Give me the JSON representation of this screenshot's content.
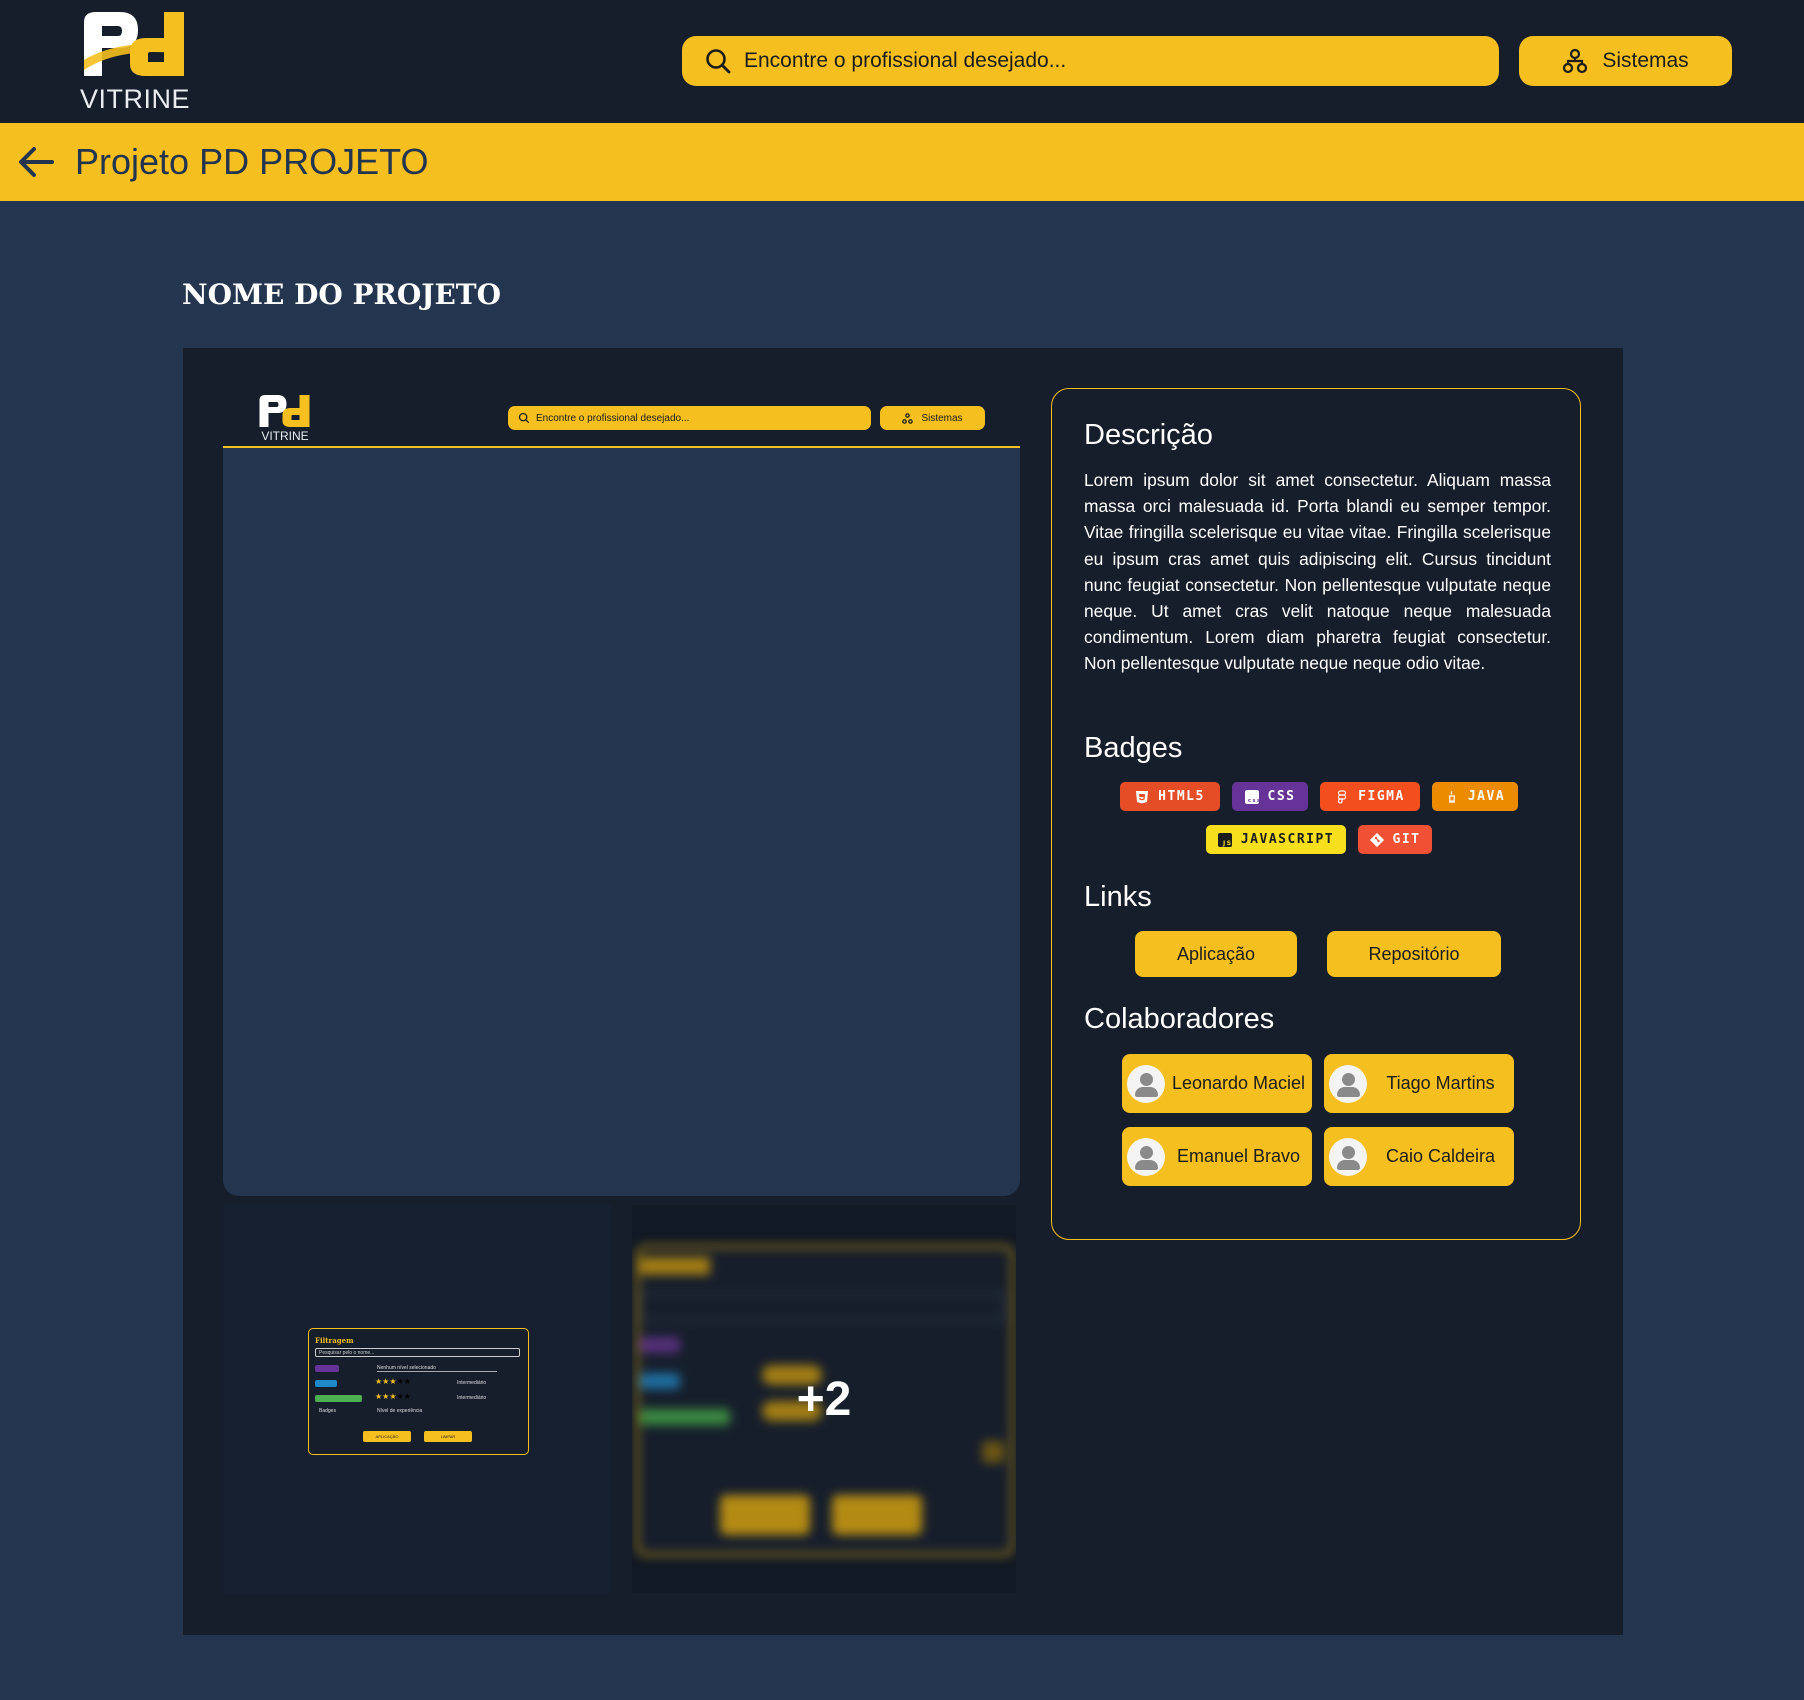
{
  "header": {
    "logo_text": "VITRINE",
    "search_placeholder": "Encontre o profissional desejado...",
    "systems_label": "Sistemas"
  },
  "breadcrumb": {
    "title": "Projeto PD PROJETO"
  },
  "project": {
    "name": "NOME DO PROJETO"
  },
  "preview": {
    "logo_text": "VITRINE",
    "search_placeholder": "Encontre o profissional desejado...",
    "systems_label": "Sistemas"
  },
  "thumbnail": {
    "title": "Filtragem",
    "search_placeholder": "Pesquisar pelo o nome...",
    "level_placeholder": "Nenhum nível selecionado",
    "level_1": "Intermediário",
    "level_2": "Intermediário",
    "badges_select": "Badges",
    "experience_select": "Nível de experiência",
    "apply_button": "APLICAÇÃO",
    "clear_button": "LIMPAR"
  },
  "gallery": {
    "more_count": "+2"
  },
  "description": {
    "heading": "Descrição",
    "text": "Lorem ipsum dolor sit amet consectetur. Aliquam massa massa orci malesuada id. Porta blandi eu semper tempor. Vitae fringilla scelerisque eu vitae vitae. Fringilla scelerisque eu ipsum cras amet quis adipiscing elit. Cursus tincidunt nunc feugiat consectetur. Non pellentesque vulputate neque neque. Ut amet cras velit natoque neque malesuada condimentum. Lorem diam pharetra feugiat consectetur. Non pellentesque vulputate neque neque odio vitae."
  },
  "badges": {
    "heading": "Badges",
    "items": [
      {
        "label": "HTML5",
        "color": "#e44d26"
      },
      {
        "label": "CSS",
        "color": "#663399"
      },
      {
        "label": "FIGMA",
        "color": "#f24e1e"
      },
      {
        "label": "JAVA",
        "color": "#ed8b00"
      },
      {
        "label": "JAVASCRIPT",
        "color": "#f7df1e"
      },
      {
        "label": "GIT",
        "color": "#f05033"
      }
    ]
  },
  "links": {
    "heading": "Links",
    "application": "Aplicação",
    "repository": "Repositório"
  },
  "collaborators": {
    "heading": "Colaboradores",
    "items": [
      {
        "name": "Leonardo Maciel"
      },
      {
        "name": "Tiago Martins"
      },
      {
        "name": "Emanuel Bravo"
      },
      {
        "name": "Caio Caldeira"
      }
    ]
  },
  "colors": {
    "accent": "#f5bf1f",
    "header_bg": "#161e2b",
    "page_bg": "#243550"
  }
}
